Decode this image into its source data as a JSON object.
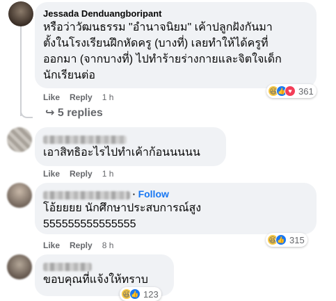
{
  "comments": [
    {
      "author": "Jessada Denduangboripant",
      "lines": [
        "หรือว่าวัฒนธรรม \"อำนาจนิยม\" เค้าปลูกฝังกันมา",
        "ตั้งในโรงเรียนฝึกหัดครู (บางที่) เลยทำให้ได้ครูที่",
        "ออกมา (จากบางที่) ไปทำร้ายร่างกายและจิตใจเด็ก",
        "นักเรียนต่อ"
      ],
      "like": "Like",
      "reply": "Reply",
      "time": "1 h",
      "reaction_count": "361",
      "reactions": [
        "haha-icon",
        "like-icon",
        "love-icon"
      ]
    },
    {
      "author": "",
      "lines": [
        "เอาสิทธิอะไรไปทำเค้าก้อนนนนน"
      ],
      "like": "Like",
      "reply": "Reply",
      "time": "1 h"
    },
    {
      "author": "",
      "follow": "Follow",
      "lines": [
        "โอ้ยยยย นักศึกษาประสบการณ์สูง",
        "555555555555555"
      ],
      "like": "Like",
      "reply": "Reply",
      "time": "8 h",
      "reaction_count": "315",
      "reactions": [
        "haha-icon",
        "like-icon"
      ]
    },
    {
      "author": "",
      "lines": [
        "ขอบคุณที่แจ้งให้ทราบ"
      ],
      "reaction_count": "123",
      "reactions": [
        "haha-icon",
        "like-icon"
      ]
    }
  ],
  "replies_label": "5 replies",
  "colors": {
    "bubble": "#f0f2f5",
    "link": "#1877f2",
    "meta": "#65676b"
  }
}
